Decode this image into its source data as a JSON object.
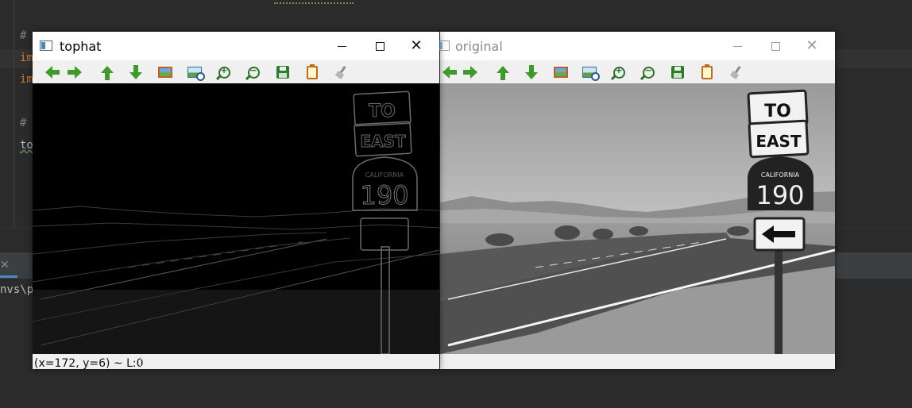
{
  "ide": {
    "code_lines": [
      "#",
      "im",
      "im",
      "#",
      "to"
    ],
    "console_text": "nvs\\p"
  },
  "window_tophat": {
    "title": "tophat",
    "status_text": "(x=172, y=6) ~ L:0",
    "icon": "app-window-icon"
  },
  "window_original": {
    "title": "original",
    "icon": "app-window-icon"
  },
  "window_controls": {
    "minimize": "minimize-icon",
    "maximize": "maximize-icon",
    "close": "close-icon",
    "close_glyph": "✕"
  },
  "toolbar": {
    "buttons": [
      "pan-left-icon",
      "pan-right-icon",
      "pan-up-icon",
      "pan-down-icon",
      "zoom-fit-icon",
      "zoom-original-icon",
      "zoom-in-icon",
      "zoom-out-icon",
      "save-icon",
      "properties-icon",
      "clear-icon"
    ]
  },
  "image_original": {
    "sign_top": "TO",
    "sign_middle": "EAST",
    "shield_label": "CALIFORNIA",
    "shield_number": "190"
  },
  "image_tophat": {
    "sign_top": "TO",
    "sign_middle": "EAST",
    "shield_label": "CALIFORNIA",
    "shield_number": "190"
  },
  "colors": {
    "ide_bg": "#2b2b2b",
    "window_bg": "#f0f0f0",
    "toolbar_green": "#3f9a2c"
  }
}
